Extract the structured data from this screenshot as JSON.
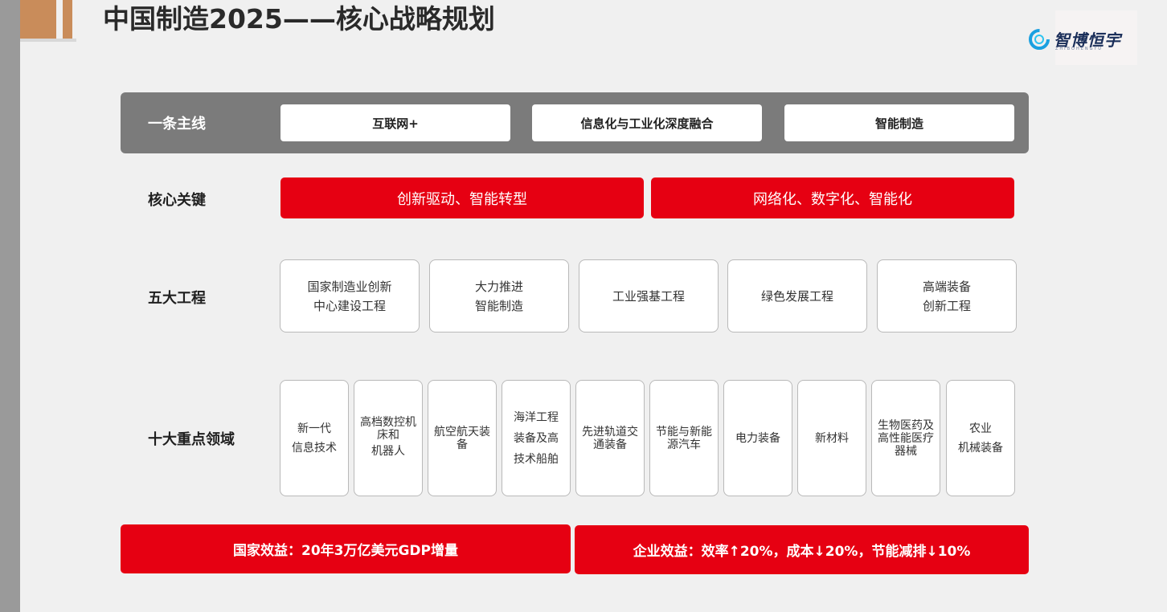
{
  "title": "中国制造2025——核心战略规划",
  "logo": {
    "name": "智博恒宇",
    "subtitle": "ZHIBOHENGYU"
  },
  "mainline": {
    "label": "一条主线",
    "items": [
      "互联网+",
      "信息化与工业化深度融合",
      "智能制造"
    ]
  },
  "core_keys": {
    "label": "核心关键",
    "items": [
      "创新驱动、智能转型",
      "网络化、数字化、智能化"
    ]
  },
  "five_projects": {
    "label": "五大工程",
    "items": [
      {
        "line1": "国家制造业创新",
        "line2": "中心建设工程"
      },
      {
        "line1": "大力推进",
        "line2": "智能制造"
      },
      {
        "line1": "工业强基工程",
        "line2": ""
      },
      {
        "line1": "绿色发展工程",
        "line2": ""
      },
      {
        "line1": "高端装备",
        "line2": "创新工程"
      }
    ]
  },
  "ten_fields": {
    "label": "十大重点领域",
    "items": [
      {
        "lines": [
          "新一代",
          "信息技术"
        ]
      },
      {
        "lines": [
          "高档数控机",
          "床和",
          "机器人"
        ]
      },
      {
        "lines": [
          "航空航天装",
          "备"
        ]
      },
      {
        "lines": [
          "海洋工程",
          "装备及高",
          "技术船舶"
        ]
      },
      {
        "lines": [
          "先进轨道交",
          "通装备"
        ]
      },
      {
        "lines": [
          "节能与新能",
          "源汽车"
        ]
      },
      {
        "lines": [
          "电力装备"
        ]
      },
      {
        "lines": [
          "新材料"
        ]
      },
      {
        "lines": [
          "生物医药及",
          "高性能医疗",
          "器械"
        ]
      },
      {
        "lines": [
          "农业",
          "机械装备"
        ]
      }
    ]
  },
  "benefits": {
    "national": "国家效益：20年3万亿美元GDP增量",
    "enterprise": "企业效益：效率↑20%，成本↓20%，节能减排↓10%"
  },
  "colors": {
    "accent_red": "#e60012",
    "band_gray": "#7b7b7b",
    "deco_copper": "#c98c5a"
  }
}
